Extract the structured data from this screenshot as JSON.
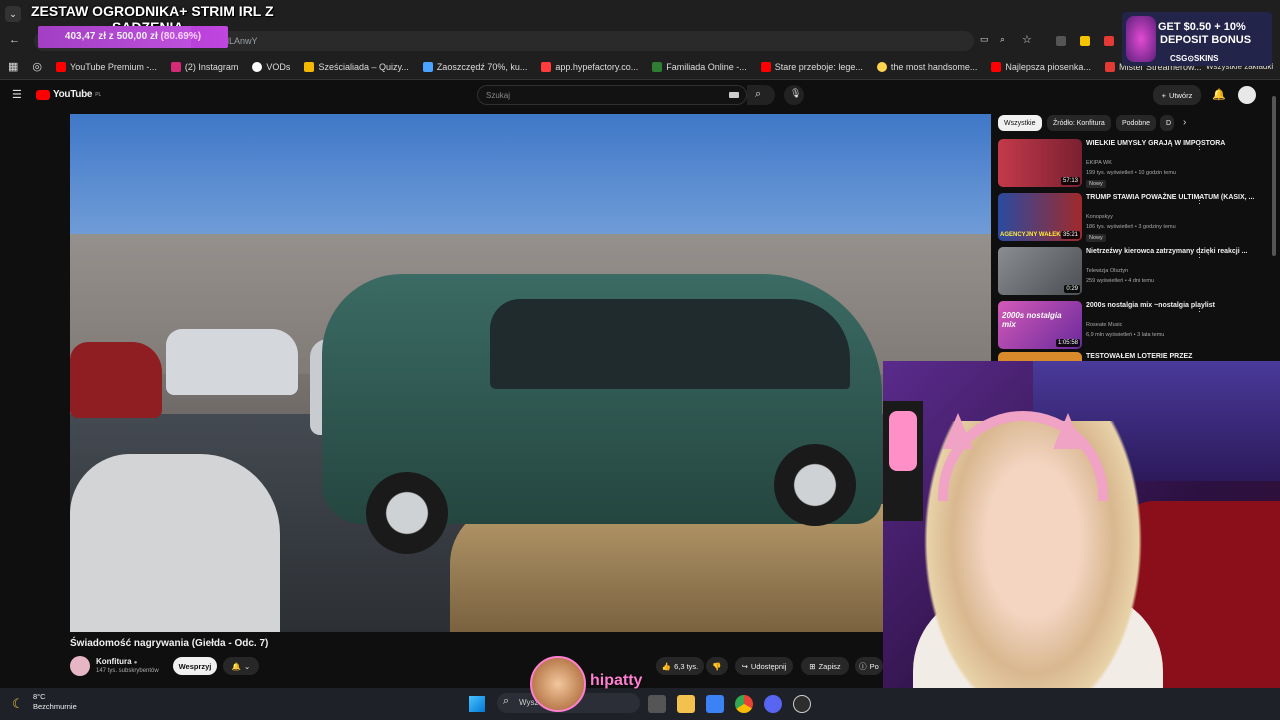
{
  "stream_overlay": {
    "title_line1": "ZESTAW OGRODNIKA+ STRIM IRL Z",
    "title_line2": "SADZENIA",
    "goal_amount": "403,47 zł z 500,00 zł",
    "goal_percent": "(80.69%)",
    "goal_fraction": 0.8069,
    "promo_line1": "GET $0.50 + 10%",
    "promo_line2": "DEPOSIT BONUS",
    "promo_brand": "CSG⊙SKINS",
    "streamer_name": "hipatty"
  },
  "browser": {
    "url_fragment": "dLAnwY",
    "all_bookmarks": "Wszystkie zakładki",
    "bookmarks": [
      {
        "label": "YouTube Premium -...",
        "color": "#ff0000"
      },
      {
        "label": "(2) Instagram",
        "color": "#d62976"
      },
      {
        "label": "VODs",
        "color": "#ffffff"
      },
      {
        "label": "Sześcialiada – Quizy...",
        "color": "#f5b800"
      },
      {
        "label": "Zaoszczędź 70%, ku...",
        "color": "#4aa3ff"
      },
      {
        "label": "app.hypefactory.co...",
        "color": "#ff3b3b"
      },
      {
        "label": "Familiada Online -...",
        "color": "#2e7d32"
      },
      {
        "label": "Stare przeboje: lege...",
        "color": "#ff0000"
      },
      {
        "label": "the most handsome...",
        "color": "#ffd54f"
      },
      {
        "label": "Najlepsza piosenka...",
        "color": "#ff0000"
      },
      {
        "label": "Mister Streamerów...",
        "color": "#e53935"
      }
    ]
  },
  "youtube": {
    "logo": "YouTube",
    "logo_region": "PL",
    "search_placeholder": "Szukaj",
    "create_label": "Utwórz",
    "video_title": "Świadomość nagrywania (Giełda - Odc. 7)",
    "channel_name": "Konfitura",
    "subscribers": "147 tys. subskrybentów",
    "support_label": "Wesprzyj",
    "likes": "6,3 tys.",
    "share_label": "Udostępnij",
    "save_label": "Zapisz",
    "more_label": "Po",
    "chips": [
      "Wszystkie",
      "Źródło: Konfitura",
      "Podobne",
      "D"
    ],
    "recommendations": [
      {
        "title": "WIELKIE UMYSŁY GRAJĄ W IMPOSTORA",
        "channel": "EKIPA WK",
        "meta": "199 tys. wyświetleń • 10 godzin temu",
        "badge": "Nowy",
        "duration": "57:13",
        "thumb_color": "#c23a4a"
      },
      {
        "title": "TRUMP STAWIA POWAŻNE ULTIMATUM (KASIX, ...",
        "channel": "Konopskyy",
        "meta": "186 tys. wyświetleń • 3 godziny temu",
        "badge": "Nowy",
        "duration": "35:21",
        "thumb_color": "#2a4aa0",
        "thumb_caption": "AGENCYJNY WAŁEK?"
      },
      {
        "title": "Nietrzeźwy kierowca zatrzymany dzięki reakcji ...",
        "channel": "Telewizja Olsztyn",
        "meta": "259 wyświetleń • 4 dni temu",
        "badge": "",
        "duration": "0:29",
        "thumb_color": "#6b6f73"
      },
      {
        "title": "2000s nostalgia mix ~nostalgia playlist",
        "channel": "Roseate Music",
        "meta": "6,9 mln wyświetleń • 3 lata temu",
        "badge": "",
        "duration": "1:05:58",
        "thumb_color": "#a13a9c",
        "thumb_caption": "2000s nostalgia mix"
      },
      {
        "title": "TESTOWAŁEM LOTERIE PRZEZ",
        "channel": "",
        "meta": "",
        "badge": "",
        "duration": "",
        "thumb_color": "#d98a2b"
      }
    ]
  },
  "taskbar": {
    "temperature": "8°C",
    "weather": "Bezchmurnie",
    "search_placeholder": "Wysz"
  }
}
